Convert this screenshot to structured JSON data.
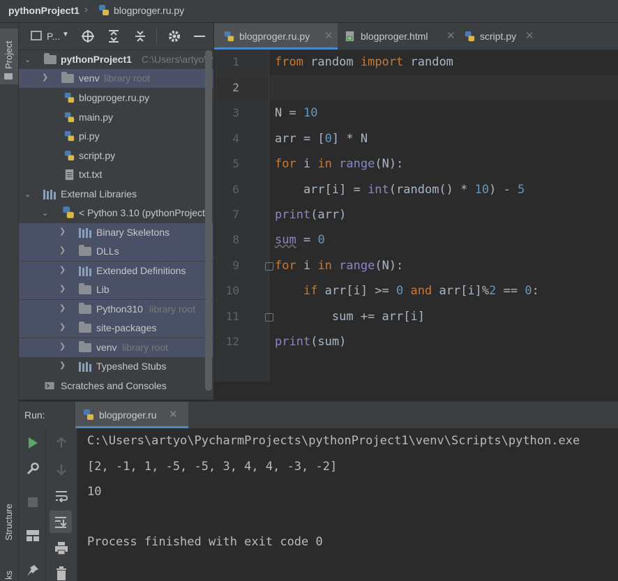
{
  "titlebar": {
    "project": "pythonProject1",
    "file": "blogproger.ru.py"
  },
  "leftstrip": {
    "project_label": "Project",
    "structure_label": "Structure",
    "bookmarks_label": "ks"
  },
  "project_panel": {
    "dropdown_label": "P...",
    "tree": [
      {
        "label": "pythonProject1",
        "hint": "C:\\Users\\artyo\\P"
      },
      {
        "label": "venv",
        "hint": "library root"
      },
      {
        "label": "blogproger.ru.py"
      },
      {
        "label": "main.py"
      },
      {
        "label": "pi.py"
      },
      {
        "label": "script.py"
      },
      {
        "label": "txt.txt"
      },
      {
        "label": "External Libraries"
      },
      {
        "label": "< Python 3.10 (pythonProject"
      },
      {
        "label": "Binary Skeletons"
      },
      {
        "label": "DLLs"
      },
      {
        "label": "Extended Definitions"
      },
      {
        "label": "Lib"
      },
      {
        "label": "Python310",
        "hint": "library root"
      },
      {
        "label": "site-packages"
      },
      {
        "label": "venv",
        "hint": "library root"
      },
      {
        "label": "Typeshed Stubs"
      },
      {
        "label": "Scratches and Consoles"
      }
    ]
  },
  "editor": {
    "tabs": [
      {
        "label": "blogproger.ru.py",
        "active": true
      },
      {
        "label": "blogproger.html",
        "active": false
      },
      {
        "label": "script.py",
        "active": false
      }
    ],
    "line_numbers": [
      "1",
      "2",
      "3",
      "4",
      "5",
      "6",
      "7",
      "8",
      "9",
      "10",
      "11",
      "12"
    ],
    "code": {
      "l1": {
        "kw1": "from",
        "mod": " random ",
        "kw2": "import",
        "name": " random"
      },
      "l3": {
        "a": "N = ",
        "n": "10"
      },
      "l4": {
        "a": "arr = [",
        "n": "0",
        "b": "] * N"
      },
      "l5": {
        "kw": "for",
        "a": " i ",
        "kw2": "in",
        "bi": " range",
        "b": "(N):"
      },
      "l6": {
        "a": "    arr[i] = ",
        "bi": "int",
        "b": "(random() * ",
        "n": "10",
        "c": ") - ",
        "n2": "5"
      },
      "l7": {
        "bi": "print",
        "a": "(arr)"
      },
      "l8": {
        "bi": "sum",
        "a": " = ",
        "n": "0"
      },
      "l9": {
        "kw": "for",
        "a": " i ",
        "kw2": "in",
        "bi": " range",
        "b": "(N):"
      },
      "l10": {
        "pre": "    ",
        "kw": "if",
        "a": " arr[i] >= ",
        "n": "0",
        "sp": " ",
        "kw2": "and",
        "b": " arr[i]%",
        "n2": "2",
        "c": " == ",
        "n3": "0",
        "d": ":"
      },
      "l11": {
        "a": "        sum += arr[i]"
      },
      "l12": {
        "bi": "print",
        "a": "(sum)"
      }
    }
  },
  "run": {
    "label": "Run:",
    "tab_label": "blogproger.ru",
    "output": [
      "C:\\Users\\artyo\\PycharmProjects\\pythonProject1\\venv\\Scripts\\python.exe",
      "[2, -1, 1, -5, -5, 3, 4, 4, -3, -2]",
      "10",
      "",
      "Process finished with exit code 0"
    ]
  },
  "colors": {
    "selection": "#4b5167",
    "accent": "#4a88c7",
    "keyword": "#cc7832",
    "builtin": "#8888c6",
    "number": "#6897bb",
    "run_green": "#59a869"
  }
}
